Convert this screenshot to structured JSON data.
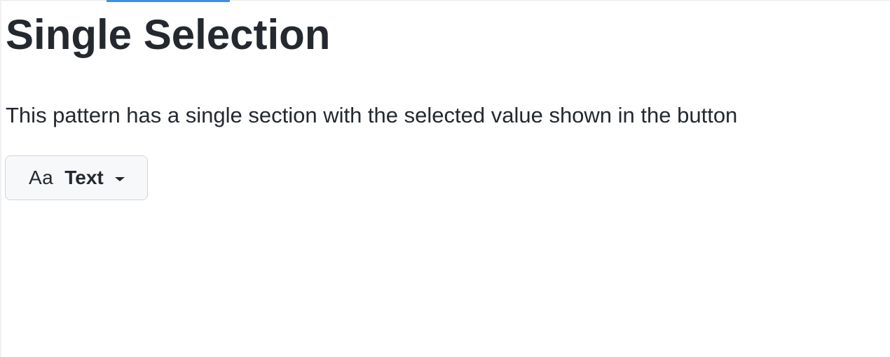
{
  "page": {
    "title": "Single Selection",
    "description": "This pattern has a single section with the selected value shown in the button"
  },
  "menu_button": {
    "leading_icon": "font-icon",
    "leading_text": "Aa",
    "label": "Text",
    "trailing_icon": "caret-down-icon"
  },
  "colors": {
    "text": "#24292f",
    "button_bg": "#f6f8fa",
    "button_border": "#d0d7de",
    "accent": "#0969da"
  }
}
